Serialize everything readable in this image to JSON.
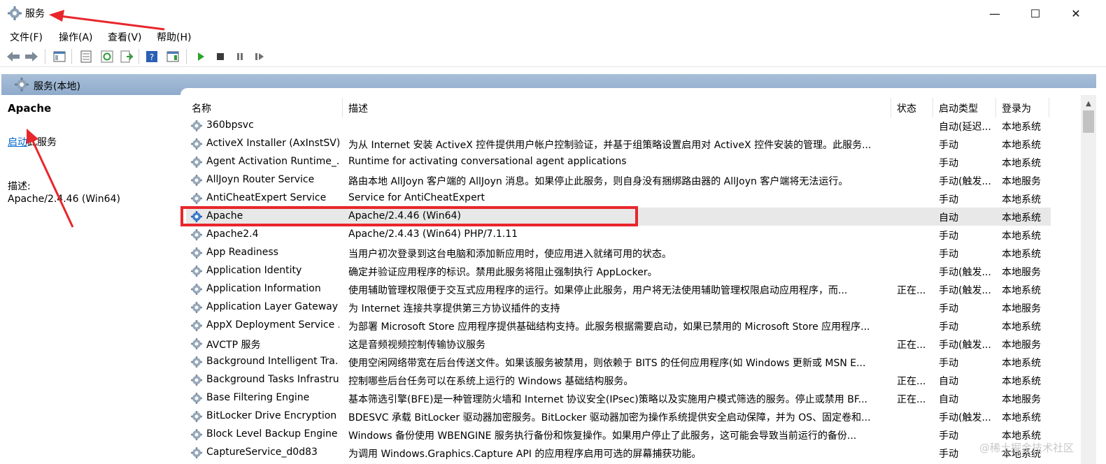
{
  "window": {
    "title": "服务",
    "minimize_glyph": "—",
    "maximize_glyph": "☐",
    "close_glyph": "✕"
  },
  "menu": [
    "文件(F)",
    "操作(A)",
    "查看(V)",
    "帮助(H)"
  ],
  "toolbar": {
    "icons": [
      "back-icon",
      "forward-icon",
      "show-hide-console-tree-icon",
      "properties-icon",
      "refresh-icon",
      "export-list-icon",
      "help-icon",
      "show-action-pane-icon",
      "start-service-icon",
      "stop-service-icon",
      "pause-service-icon",
      "restart-service-icon"
    ]
  },
  "header_band": {
    "label": "服务(本地)"
  },
  "left_pane": {
    "title": "Apache",
    "action_link": "启动",
    "action_suffix": "此服务",
    "desc_label": "描述:",
    "desc_value": "Apache/2.4.46 (Win64)"
  },
  "table": {
    "columns": [
      "名称",
      "描述",
      "状态",
      "启动类型",
      "登录为"
    ],
    "rows": [
      {
        "name": "360bpsvc",
        "desc": "",
        "status": "",
        "startup": "自动(延迟...",
        "logon": "本地系统"
      },
      {
        "name": "ActiveX Installer (AxInstSV)",
        "desc": "为从 Internet 安装 ActiveX 控件提供用户帐户控制验证，并基于组策略设置启用对 ActiveX 控件安装的管理。此服务...",
        "status": "",
        "startup": "手动",
        "logon": "本地系统"
      },
      {
        "name": "Agent Activation Runtime_...",
        "desc": "Runtime for activating conversational agent applications",
        "status": "",
        "startup": "手动",
        "logon": "本地系统"
      },
      {
        "name": "AllJoyn Router Service",
        "desc": "路由本地 AllJoyn 客户端的 AllJoyn 消息。如果停止此服务，则自身没有捆绑路由器的 AllJoyn 客户端将无法运行。",
        "status": "",
        "startup": "手动(触发...",
        "logon": "本地服务"
      },
      {
        "name": "AntiCheatExpert Service",
        "desc": "Service for AntiCheatExpert",
        "status": "",
        "startup": "手动",
        "logon": "本地系统"
      },
      {
        "name": "Apache",
        "desc": "Apache/2.4.46 (Win64)",
        "status": "",
        "startup": "自动",
        "logon": "本地系统"
      },
      {
        "name": "Apache2.4",
        "desc": "Apache/2.4.43 (Win64) PHP/7.1.11",
        "status": "",
        "startup": "手动",
        "logon": "本地系统"
      },
      {
        "name": "App Readiness",
        "desc": "当用户初次登录到这台电脑和添加新应用时，使应用进入就绪可用的状态。",
        "status": "",
        "startup": "手动",
        "logon": "本地系统"
      },
      {
        "name": "Application Identity",
        "desc": "确定并验证应用程序的标识。禁用此服务将阻止强制执行 AppLocker。",
        "status": "",
        "startup": "手动(触发...",
        "logon": "本地服务"
      },
      {
        "name": "Application Information",
        "desc": "使用辅助管理权限便于交互式应用程序的运行。如果停止此服务，用户将无法使用辅助管理权限启动应用程序，而...",
        "status": "正在...",
        "startup": "手动(触发...",
        "logon": "本地系统"
      },
      {
        "name": "Application Layer Gateway ...",
        "desc": "为 Internet 连接共享提供第三方协议插件的支持",
        "status": "",
        "startup": "手动",
        "logon": "本地服务"
      },
      {
        "name": "AppX Deployment Service ...",
        "desc": "为部署 Microsoft Store 应用程序提供基础结构支持。此服务根据需要启动，如果已禁用的 Microsoft Store 应用程序...",
        "status": "",
        "startup": "手动",
        "logon": "本地系统"
      },
      {
        "name": "AVCTP 服务",
        "desc": "这是音频视频控制传输协议服务",
        "status": "正在...",
        "startup": "手动(触发...",
        "logon": "本地服务"
      },
      {
        "name": "Background Intelligent Tra...",
        "desc": "使用空闲网络带宽在后台传送文件。如果该服务被禁用，则依赖于 BITS 的任何应用程序(如 Windows 更新或 MSN E...",
        "status": "",
        "startup": "手动",
        "logon": "本地系统"
      },
      {
        "name": "Background Tasks Infrastru...",
        "desc": "控制哪些后台任务可以在系统上运行的 Windows 基础结构服务。",
        "status": "正在...",
        "startup": "自动",
        "logon": "本地系统"
      },
      {
        "name": "Base Filtering Engine",
        "desc": "基本筛选引擎(BFE)是一种管理防火墙和 Internet 协议安全(IPsec)策略以及实施用户模式筛选的服务。停止或禁用 BF...",
        "status": "正在...",
        "startup": "自动",
        "logon": "本地服务"
      },
      {
        "name": "BitLocker Drive Encryption ...",
        "desc": "BDESVC 承载 BitLocker 驱动器加密服务。BitLocker 驱动器加密为操作系统提供安全启动保障，并为 OS、固定卷和...",
        "status": "",
        "startup": "手动(触发...",
        "logon": "本地系统"
      },
      {
        "name": "Block Level Backup Engine ...",
        "desc": "Windows 备份使用 WBENGINE 服务执行备份和恢复操作。如果用户停止了此服务，这可能会导致当前运行的备份...",
        "status": "",
        "startup": "手动",
        "logon": "本地系统"
      },
      {
        "name": "CaptureService_d0d83",
        "desc": "为调用 Windows.Graphics.Capture API 的应用程序启用可选的屏幕捕获功能。",
        "status": "",
        "startup": "手动",
        "logon": "本地系统"
      }
    ]
  },
  "watermark": "@稀土掘金技术社区",
  "colors": {
    "band": "#8fabcb",
    "highlight_border": "#e8262b",
    "link": "#0066cc",
    "selected_row": "#e8e8e8"
  }
}
